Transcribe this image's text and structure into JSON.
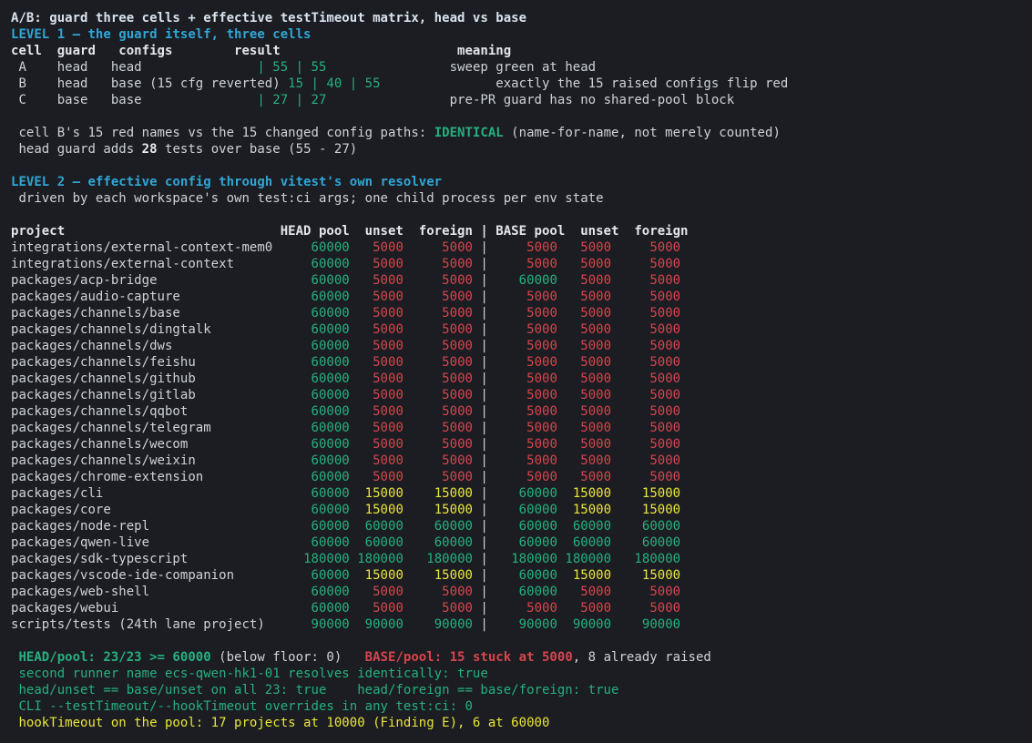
{
  "title": "A/B: guard three cells + effective testTimeout matrix, head vs base",
  "level1": {
    "heading": "LEVEL 1 — the guard itself, three cells",
    "table_header": "cell  guard   configs        result                       meaning",
    "rows": [
      {
        "cell": " A    head   head               ",
        "result": "| 55 | 55",
        "pad": "                ",
        "meaning": "sweep green at head"
      },
      {
        "cell": " B    head   base (15 cfg reverted) ",
        "result": "15 | 40 | 55",
        "pad": "               ",
        "meaning": "exactly the 15 raised configs flip red"
      },
      {
        "cell": " C    base   base               ",
        "result": "| 27 | 27",
        "pad": "                ",
        "meaning": "pre-PR guard has no shared-pool block"
      }
    ],
    "identical_prefix": " cell B's 15 red names vs the 15 changed config paths: ",
    "identical_word": "IDENTICAL",
    "identical_suffix": " (name-for-name, not merely counted)",
    "adds_prefix": " head guard adds ",
    "adds_count": "28",
    "adds_suffix": " tests over base (55 - 27)"
  },
  "level2": {
    "heading": "LEVEL 2 — effective config through vitest's own resolver",
    "subheading": " driven by each workspace's own test:ci args; one child process per env state",
    "table_header": "project                            HEAD pool  unset  foreign | BASE pool  unset  foreign",
    "rows": [
      {
        "project": "integrations/external-context-mem0",
        "head": [
          "60000",
          "5000",
          "5000"
        ],
        "base": [
          "5000",
          "5000",
          "5000"
        ]
      },
      {
        "project": "integrations/external-context",
        "head": [
          "60000",
          "5000",
          "5000"
        ],
        "base": [
          "5000",
          "5000",
          "5000"
        ]
      },
      {
        "project": "packages/acp-bridge",
        "head": [
          "60000",
          "5000",
          "5000"
        ],
        "base": [
          "60000",
          "5000",
          "5000"
        ]
      },
      {
        "project": "packages/audio-capture",
        "head": [
          "60000",
          "5000",
          "5000"
        ],
        "base": [
          "5000",
          "5000",
          "5000"
        ]
      },
      {
        "project": "packages/channels/base",
        "head": [
          "60000",
          "5000",
          "5000"
        ],
        "base": [
          "5000",
          "5000",
          "5000"
        ]
      },
      {
        "project": "packages/channels/dingtalk",
        "head": [
          "60000",
          "5000",
          "5000"
        ],
        "base": [
          "5000",
          "5000",
          "5000"
        ]
      },
      {
        "project": "packages/channels/dws",
        "head": [
          "60000",
          "5000",
          "5000"
        ],
        "base": [
          "5000",
          "5000",
          "5000"
        ]
      },
      {
        "project": "packages/channels/feishu",
        "head": [
          "60000",
          "5000",
          "5000"
        ],
        "base": [
          "5000",
          "5000",
          "5000"
        ]
      },
      {
        "project": "packages/channels/github",
        "head": [
          "60000",
          "5000",
          "5000"
        ],
        "base": [
          "5000",
          "5000",
          "5000"
        ]
      },
      {
        "project": "packages/channels/gitlab",
        "head": [
          "60000",
          "5000",
          "5000"
        ],
        "base": [
          "5000",
          "5000",
          "5000"
        ]
      },
      {
        "project": "packages/channels/qqbot",
        "head": [
          "60000",
          "5000",
          "5000"
        ],
        "base": [
          "5000",
          "5000",
          "5000"
        ]
      },
      {
        "project": "packages/channels/telegram",
        "head": [
          "60000",
          "5000",
          "5000"
        ],
        "base": [
          "5000",
          "5000",
          "5000"
        ]
      },
      {
        "project": "packages/channels/wecom",
        "head": [
          "60000",
          "5000",
          "5000"
        ],
        "base": [
          "5000",
          "5000",
          "5000"
        ]
      },
      {
        "project": "packages/channels/weixin",
        "head": [
          "60000",
          "5000",
          "5000"
        ],
        "base": [
          "5000",
          "5000",
          "5000"
        ]
      },
      {
        "project": "packages/chrome-extension",
        "head": [
          "60000",
          "5000",
          "5000"
        ],
        "base": [
          "5000",
          "5000",
          "5000"
        ]
      },
      {
        "project": "packages/cli",
        "head": [
          "60000",
          "15000",
          "15000"
        ],
        "base": [
          "60000",
          "15000",
          "15000"
        ]
      },
      {
        "project": "packages/core",
        "head": [
          "60000",
          "15000",
          "15000"
        ],
        "base": [
          "60000",
          "15000",
          "15000"
        ]
      },
      {
        "project": "packages/node-repl",
        "head": [
          "60000",
          "60000",
          "60000"
        ],
        "base": [
          "60000",
          "60000",
          "60000"
        ]
      },
      {
        "project": "packages/qwen-live",
        "head": [
          "60000",
          "60000",
          "60000"
        ],
        "base": [
          "60000",
          "60000",
          "60000"
        ]
      },
      {
        "project": "packages/sdk-typescript",
        "head": [
          "180000",
          "180000",
          "180000"
        ],
        "base": [
          "180000",
          "180000",
          "180000"
        ]
      },
      {
        "project": "packages/vscode-ide-companion",
        "head": [
          "60000",
          "15000",
          "15000"
        ],
        "base": [
          "60000",
          "15000",
          "15000"
        ]
      },
      {
        "project": "packages/web-shell",
        "head": [
          "60000",
          "5000",
          "5000"
        ],
        "base": [
          "60000",
          "5000",
          "5000"
        ]
      },
      {
        "project": "packages/webui",
        "head": [
          "60000",
          "5000",
          "5000"
        ],
        "base": [
          "5000",
          "5000",
          "5000"
        ]
      },
      {
        "project": "scripts/tests (24th lane project)",
        "head": [
          "90000",
          "90000",
          "90000"
        ],
        "base": [
          "90000",
          "90000",
          "90000"
        ]
      }
    ]
  },
  "summary": {
    "head_pool": "HEAD/pool: 23/23 >= 60000",
    "head_pool_note": " (below floor: 0)   ",
    "base_pool": "BASE/pool: 15 stuck at 5000",
    "base_pool_note": ", 8 already raised",
    "line2": " second runner name ecs-qwen-hk1-01 resolves identically: true",
    "line3": " head/unset == base/unset on all 23: true    head/foreign == base/foreign: true",
    "line4": " CLI --testTimeout/--hookTimeout overrides in any test:ci: 0",
    "line5": " hookTimeout on the pool: 17 projects at 10000 (Finding E), 6 at 60000"
  },
  "colors": {
    "background": "#1b1d22",
    "text": "#cfd2d6",
    "heading": "#2fa6d6",
    "green": "#26b07e",
    "red": "#d6454c",
    "yellow": "#ece53a"
  }
}
